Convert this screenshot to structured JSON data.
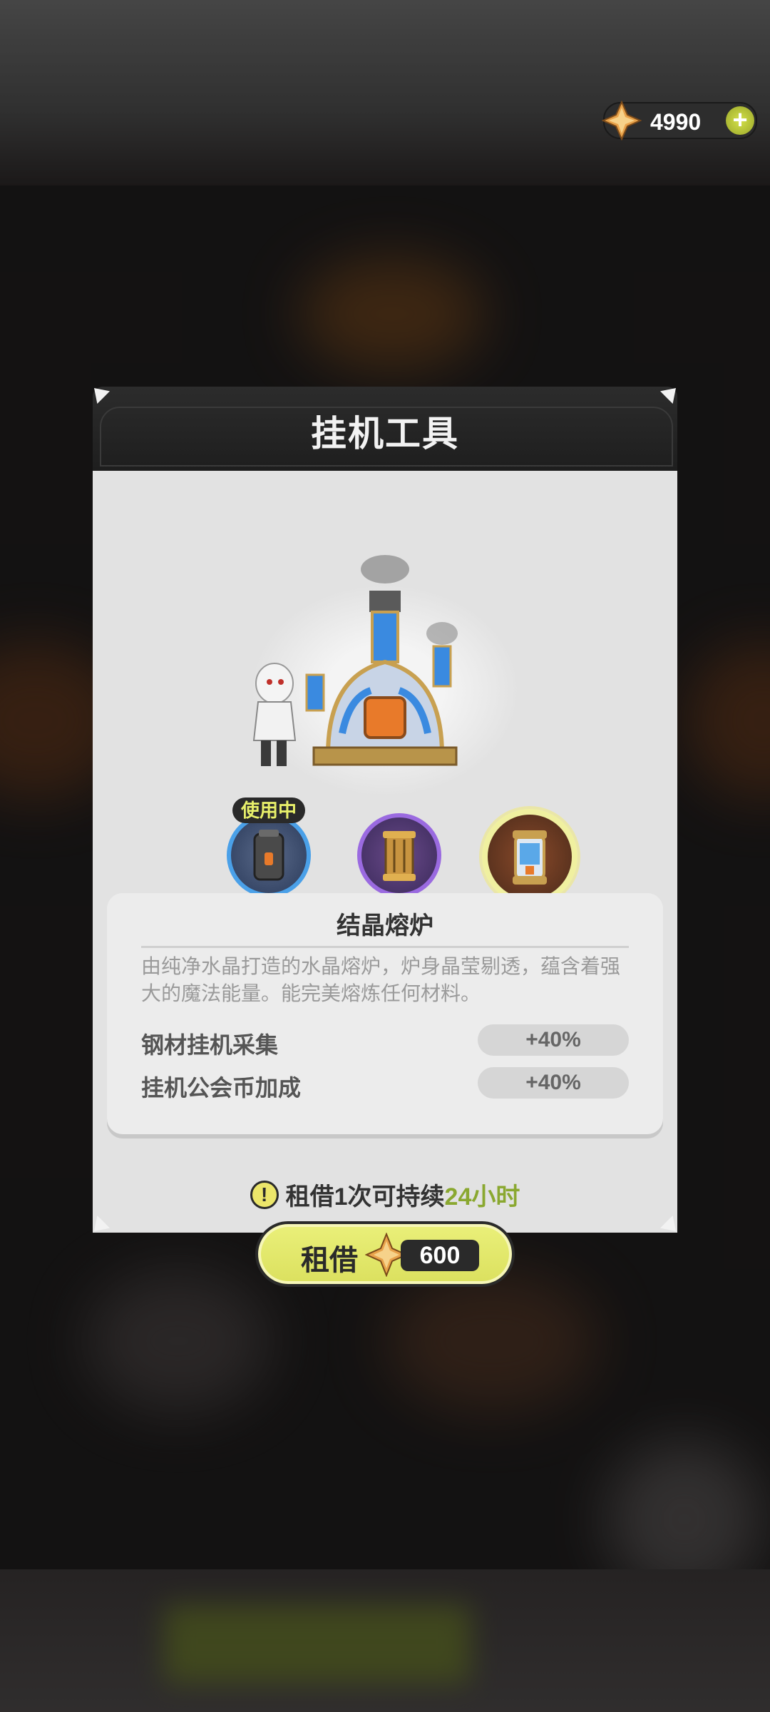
{
  "currency": {
    "amount": "4990",
    "icon": "crystal-gem-icon",
    "add_icon": "plus-icon"
  },
  "dialog": {
    "title": "挂机工具",
    "tools": [
      {
        "icon": "gray-canister-icon",
        "ring_color": "#4aa0e8",
        "status": "使用中"
      },
      {
        "icon": "golden-lantern-icon",
        "ring_color": "#9a6ae0"
      },
      {
        "icon": "crystal-furnace-icon",
        "ring_color": "#f0f0a0",
        "selected": true
      }
    ],
    "item": {
      "name": "结晶熔炉",
      "description": "由纯净水晶打造的水晶熔炉，炉身晶莹剔透，蕴含着强大的魔法能量。能完美熔炼任何材料。",
      "stats": [
        {
          "label": "钢材挂机采集",
          "value": "+40%"
        },
        {
          "label": "挂机公会币加成",
          "value": "+40%"
        }
      ]
    },
    "notice": {
      "text": "租借1次可持续",
      "highlight": "24小时",
      "icon": "exclamation-icon"
    },
    "rent_button": {
      "label": "租借",
      "price": "600",
      "icon": "crystal-gem-icon"
    }
  },
  "colors": {
    "accent_yellow": "#e8f06a",
    "highlight_green": "#8aa830",
    "panel": "#e2e2e2"
  }
}
